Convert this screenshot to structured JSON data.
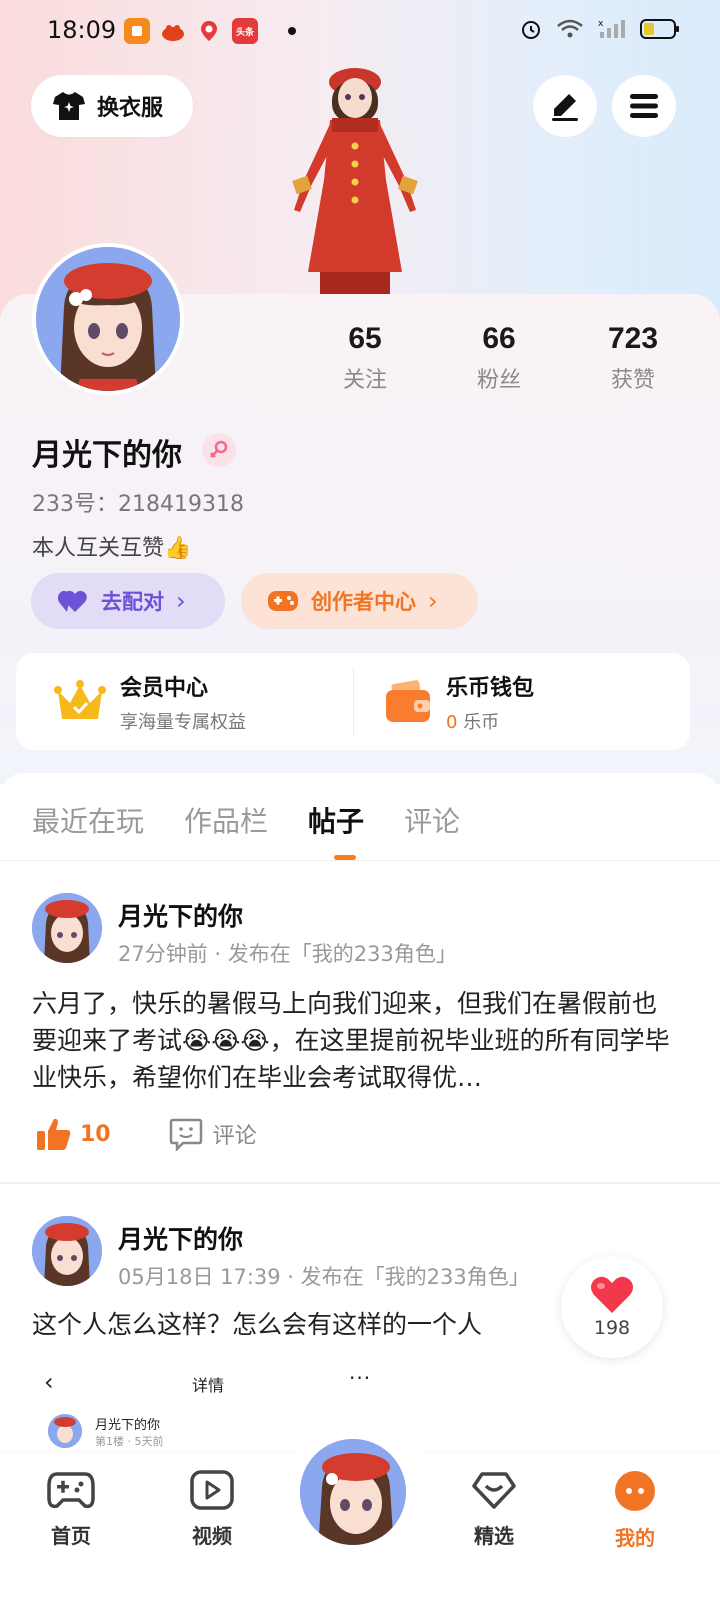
{
  "status_bar": {
    "time": "18:09",
    "app_icons": [
      "orange-app-icon",
      "crab-app-icon",
      "red-map-app-icon",
      "toutiao-app-icon"
    ],
    "toutiao_label": "头条",
    "right_icons": [
      "alarm-icon",
      "wifi-icon",
      "signal-icon",
      "battery-icon"
    ]
  },
  "header": {
    "outfit_label": "换衣服",
    "edit_icon": "pen-icon",
    "menu_icon": "menu-icon"
  },
  "profile": {
    "stats": [
      {
        "value": "65",
        "label": "关注"
      },
      {
        "value": "66",
        "label": "粉丝"
      },
      {
        "value": "723",
        "label": "获赞"
      }
    ],
    "username": "月光下的你",
    "gender": "female",
    "uid": "233号：218419318",
    "bio": "本人互关互赞👍",
    "match_button": "去配对",
    "creator_button": "创作者中心"
  },
  "member_card": {
    "vip_title": "会员中心",
    "vip_sub": "享海量专属权益",
    "wallet_title": "乐币钱包",
    "wallet_amount": "0",
    "wallet_unit": "乐币"
  },
  "tabs": [
    "最近在玩",
    "作品栏",
    "帖子",
    "评论"
  ],
  "active_tab": "帖子",
  "posts": [
    {
      "author": "月光下的你",
      "meta": "27分钟前 · 发布在「我的233角色」",
      "text": "六月了，快乐的暑假马上向我们迎来，但我们在暑假前也要迎来了考试😭😭😭，在这里提前祝毕业班的所有同学毕业快乐，希望你们在毕业会考试取得优…",
      "likes": "10",
      "comment_label": "评论"
    },
    {
      "author": "月光下的你",
      "meta": "05月18日 17:39 · 发布在「我的233角色」",
      "text": "这个人怎么这样？怎么会有这样的一个人"
    }
  ],
  "embedded_preview": {
    "back": "‹",
    "title": "详情",
    "more": "···",
    "name": "月光下的你",
    "sub": "第1楼 · 5天前"
  },
  "floating_like": {
    "count": "198"
  },
  "bottom_nav": [
    {
      "label": "首页",
      "icon": "gamepad-icon"
    },
    {
      "label": "视频",
      "icon": "play-icon"
    },
    {
      "label": "",
      "icon": "avatar-center"
    },
    {
      "label": "精选",
      "icon": "heart-diamond-icon"
    },
    {
      "label": "我的",
      "icon": "profile-face-icon"
    }
  ],
  "colors": {
    "accent": "#f07424",
    "match_purple": "#6b52d6"
  }
}
